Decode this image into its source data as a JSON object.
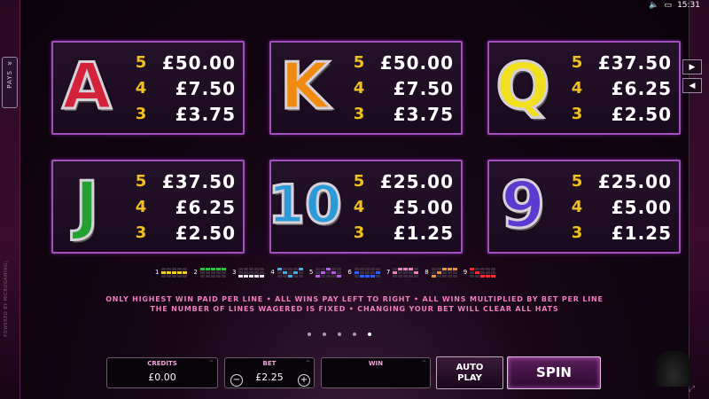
{
  "status": {
    "time": "15:31",
    "sound_icon": "speaker-icon",
    "battery_icon": "battery-icon"
  },
  "side_tab": {
    "label": "PAYS",
    "icon": "chevron-double-right-icon"
  },
  "powered_by": "POWERED BY MICROGAMING™",
  "nav": {
    "next_icon": "triangle-right-icon",
    "prev_icon": "triangle-left-icon"
  },
  "paytable": [
    {
      "symbol": "A",
      "symbol_color": "#d4223a",
      "extra": "playing-cards",
      "rows": [
        {
          "count": "5",
          "amount": "£50.00"
        },
        {
          "count": "4",
          "amount": "£7.50"
        },
        {
          "count": "3",
          "amount": "£3.75"
        }
      ]
    },
    {
      "symbol": "K",
      "symbol_color": "#f08a10",
      "extra": "ring",
      "rows": [
        {
          "count": "5",
          "amount": "£50.00"
        },
        {
          "count": "4",
          "amount": "£7.50"
        },
        {
          "count": "3",
          "amount": "£3.75"
        }
      ]
    },
    {
      "symbol": "Q",
      "symbol_color": "#f0e020",
      "extra": "feather",
      "rows": [
        {
          "count": "5",
          "amount": "£37.50"
        },
        {
          "count": "4",
          "amount": "£6.25"
        },
        {
          "count": "3",
          "amount": "£2.50"
        }
      ]
    },
    {
      "symbol": "J",
      "symbol_color": "#22a030",
      "extra": "pocket-watch",
      "rows": [
        {
          "count": "5",
          "amount": "£37.50"
        },
        {
          "count": "4",
          "amount": "£6.25"
        },
        {
          "count": "3",
          "amount": "£2.50"
        }
      ]
    },
    {
      "symbol": "10",
      "symbol_color": "#2a9ad8",
      "extra": "",
      "rows": [
        {
          "count": "5",
          "amount": "£25.00"
        },
        {
          "count": "4",
          "amount": "£5.00"
        },
        {
          "count": "3",
          "amount": "£1.25"
        }
      ]
    },
    {
      "symbol": "9",
      "symbol_color": "#5a3ad0",
      "extra": "",
      "rows": [
        {
          "count": "5",
          "amount": "£25.00"
        },
        {
          "count": "4",
          "amount": "£5.00"
        },
        {
          "count": "3",
          "amount": "£1.25"
        }
      ]
    }
  ],
  "paylines": [
    {
      "num": "1",
      "color": "#f0d020",
      "cells": [
        0,
        0,
        0,
        0,
        0,
        1,
        1,
        1,
        1,
        1,
        0,
        0,
        0,
        0,
        0
      ]
    },
    {
      "num": "2",
      "color": "#30c040",
      "cells": [
        1,
        1,
        1,
        1,
        1,
        0,
        0,
        0,
        0,
        0,
        0,
        0,
        0,
        0,
        0
      ]
    },
    {
      "num": "3",
      "color": "#e8e8e8",
      "cells": [
        0,
        0,
        0,
        0,
        0,
        0,
        0,
        0,
        0,
        0,
        1,
        1,
        1,
        1,
        1
      ]
    },
    {
      "num": "4",
      "color": "#3ab0f0",
      "cells": [
        1,
        0,
        0,
        0,
        1,
        0,
        1,
        0,
        1,
        0,
        0,
        0,
        1,
        0,
        0
      ]
    },
    {
      "num": "5",
      "color": "#b060e0",
      "cells": [
        0,
        0,
        1,
        0,
        0,
        0,
        1,
        0,
        1,
        0,
        1,
        0,
        0,
        0,
        1
      ]
    },
    {
      "num": "6",
      "color": "#3060f0",
      "cells": [
        0,
        0,
        0,
        0,
        0,
        1,
        0,
        0,
        0,
        1,
        0,
        1,
        1,
        1,
        0
      ]
    },
    {
      "num": "7",
      "color": "#f080c0",
      "cells": [
        0,
        1,
        1,
        1,
        0,
        1,
        0,
        0,
        0,
        1,
        0,
        0,
        0,
        0,
        0
      ]
    },
    {
      "num": "8",
      "color": "#f09030",
      "cells": [
        0,
        0,
        1,
        1,
        1,
        0,
        1,
        0,
        0,
        0,
        1,
        0,
        0,
        0,
        0
      ]
    },
    {
      "num": "9",
      "color": "#f03030",
      "cells": [
        1,
        0,
        0,
        0,
        0,
        0,
        1,
        0,
        0,
        0,
        0,
        0,
        1,
        1,
        1
      ]
    }
  ],
  "rules": {
    "line1": "ONLY HIGHEST WIN PAID PER LINE • ALL WINS PAY LEFT TO RIGHT • ALL WINS MULTIPLIED BY BET PER LINE",
    "line2": "THE NUMBER OF LINES WAGERED IS FIXED • CHANGING YOUR BET WILL CLEAR ALL HATS"
  },
  "pager": {
    "total": 5,
    "active": 5
  },
  "controls": {
    "credits_label": "CREDITS",
    "credits_value": "£0.00",
    "bet_label": "BET",
    "bet_value": "£2.25",
    "bet_minus": "−",
    "bet_plus": "+",
    "win_label": "WIN",
    "win_value": "",
    "autoplay_line1": "AUTO",
    "autoplay_line2": "PLAY",
    "spin_label": "SPIN",
    "caret": "^"
  },
  "colors": {
    "panel_border": "#a24fc0",
    "count_color": "#f0c020",
    "rules_color": "#f07cc0"
  }
}
